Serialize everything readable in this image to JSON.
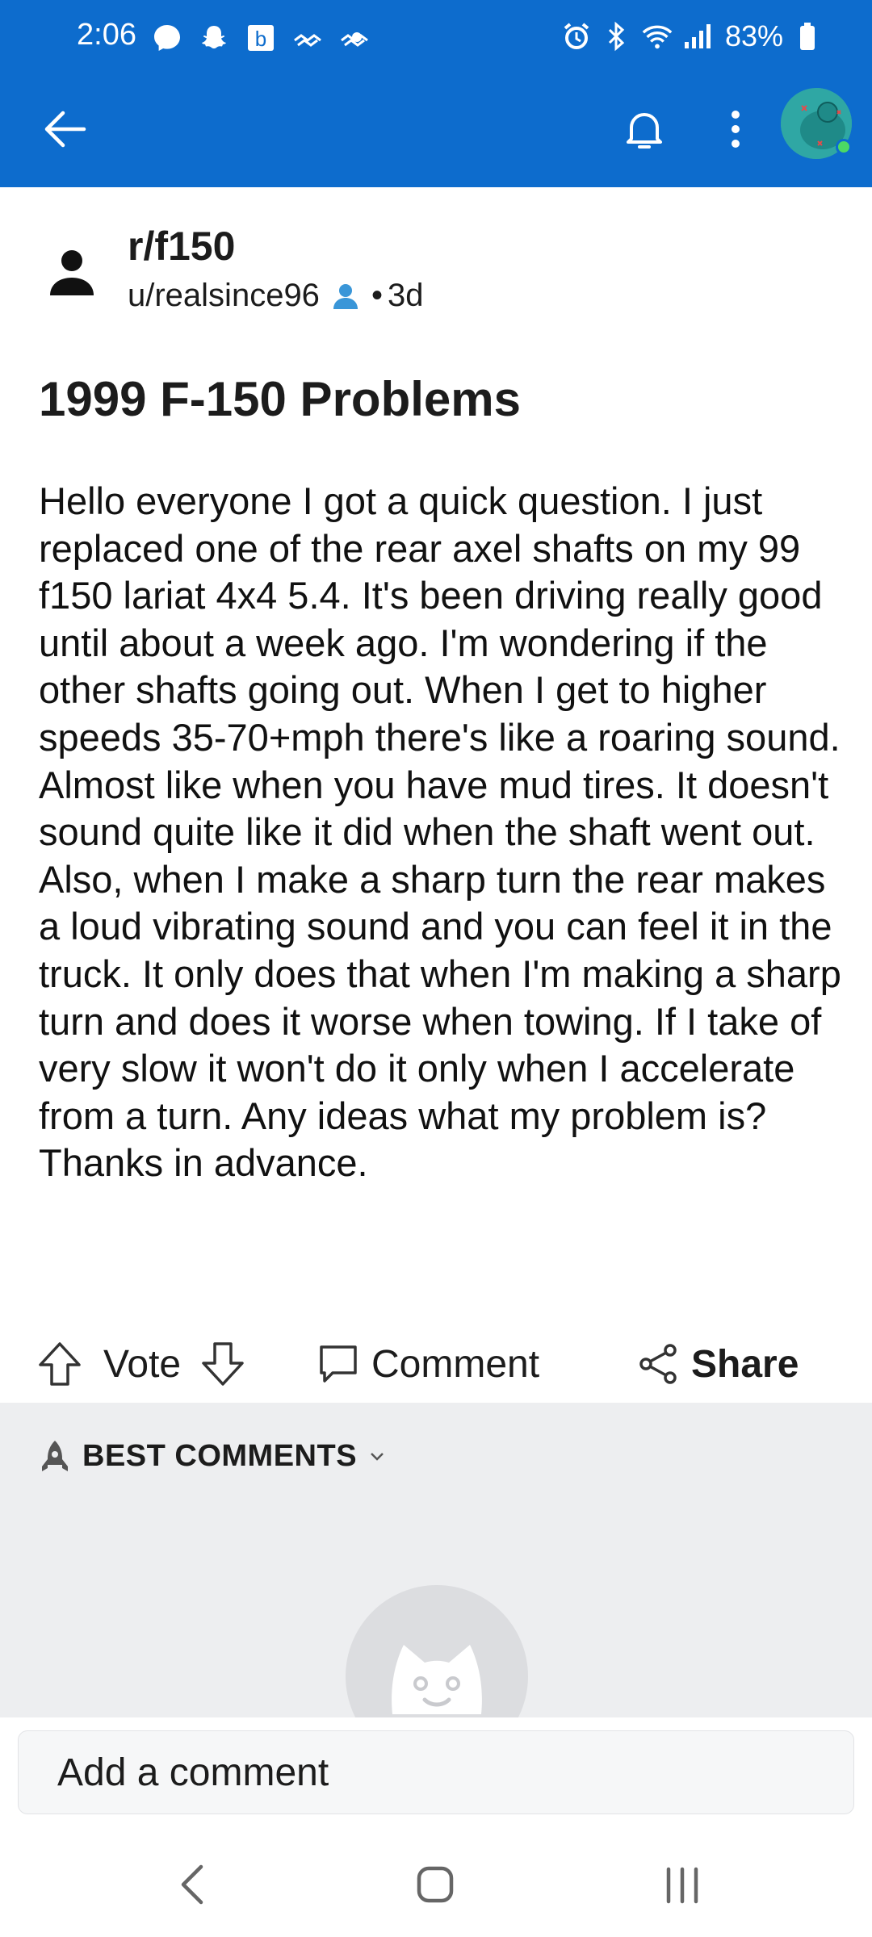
{
  "status_bar": {
    "time": "2:06",
    "left_icons": [
      "messenger-icon",
      "snapchat-icon",
      "b-app-icon",
      "signal-wave-icon",
      "signal-wave-icon"
    ],
    "right_icons": [
      "alarm-icon",
      "bluetooth-icon",
      "wifi-icon",
      "cellular-signal-icon"
    ],
    "battery": "83%"
  },
  "app_bar": {
    "back_icon": "arrow-left-icon",
    "notifications_icon": "bell-icon",
    "more_icon": "more-vertical-icon",
    "accent_color": "#0d6ccd"
  },
  "post": {
    "subreddit": "r/f150",
    "author": "u/realsince96",
    "separator": "•",
    "age": "3d",
    "title": "1999 F-150 Problems",
    "body": "Hello everyone I got a quick question. I just replaced one of the rear axel shafts on my 99 f150 lariat 4x4 5.4. It's been driving really good until about a week ago. I'm wondering if the other shafts going out. When I get to higher speeds 35-70+mph there's like a roaring sound. Almost like when you have mud tires. It doesn't sound quite like it did when the shaft went out. Also, when I make a sharp turn the rear makes a loud vibrating sound and you can feel it in the truck. It only does that when I'm making a sharp turn and does it worse when towing. If I take of very slow it won't do it only when I accelerate from a turn. Any ideas what my problem is? Thanks in advance."
  },
  "actions": {
    "vote_label": "Vote",
    "comment_label": "Comment",
    "share_label": "Share"
  },
  "comments": {
    "sort_label": "BEST COMMENTS",
    "input_placeholder": "Add a comment"
  }
}
